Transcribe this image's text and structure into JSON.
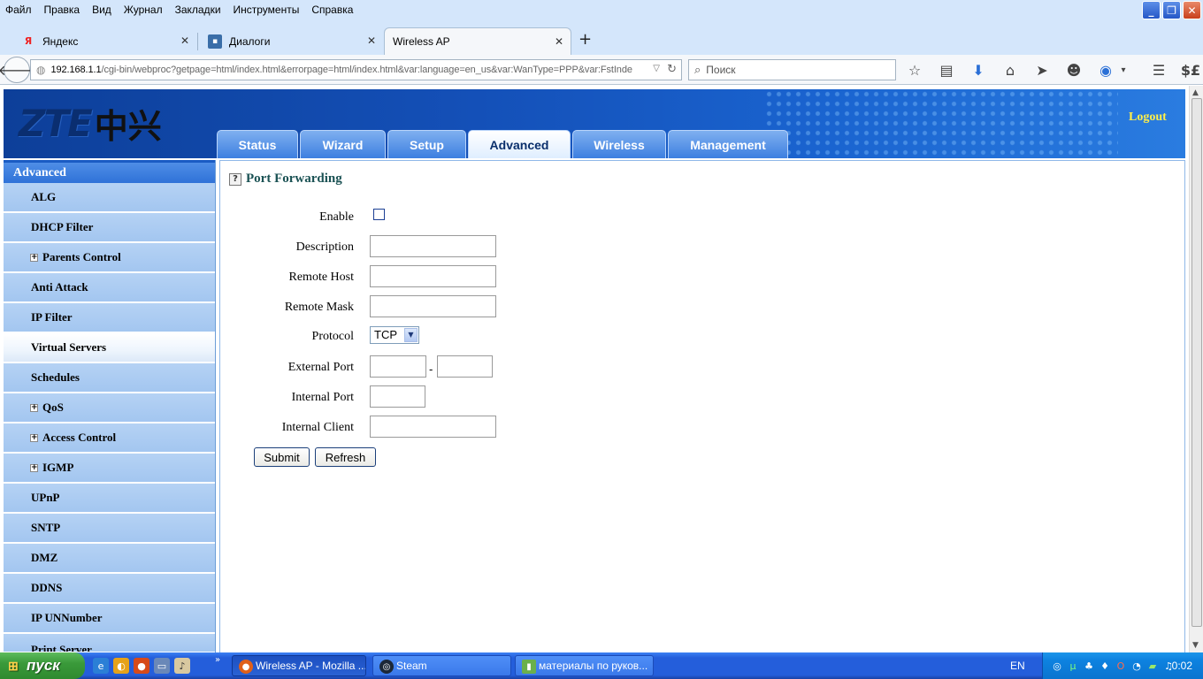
{
  "browser": {
    "menu": [
      "Файл",
      "Правка",
      "Вид",
      "Журнал",
      "Закладки",
      "Инструменты",
      "Справка"
    ],
    "window_buttons": {
      "minimize": "_",
      "restore": "❐",
      "close": "✕"
    },
    "tabs": [
      {
        "label": "Яндекс",
        "favicon": "Я"
      },
      {
        "label": "Диалоги",
        "favicon": "▪"
      },
      {
        "label": "Wireless AP",
        "favicon": ""
      }
    ],
    "newtab_glyph": "+",
    "url": {
      "host": "192.168.1.1",
      "path": "/cgi-bin/webproc?getpage=html/index.html&errorpage=html/index.html&var:language=en_us&var:WanType=PPP&var:FstInde"
    },
    "search_placeholder": "Поиск"
  },
  "router": {
    "logo_latin": "ZTE",
    "logo_cn": "中兴",
    "logout": "Logout",
    "tabs": [
      {
        "label": "Status",
        "active": false
      },
      {
        "label": "Wizard",
        "active": false
      },
      {
        "label": "Setup",
        "active": false
      },
      {
        "label": "Advanced",
        "active": true
      },
      {
        "label": "Wireless",
        "active": false
      },
      {
        "label": "Management",
        "active": false
      }
    ],
    "sidebar": {
      "heading": "Advanced",
      "items": [
        {
          "label": "ALG",
          "expandable": false
        },
        {
          "label": "DHCP Filter",
          "expandable": false
        },
        {
          "label": "Parents Control",
          "expandable": true
        },
        {
          "label": "Anti Attack",
          "expandable": false
        },
        {
          "label": "IP Filter",
          "expandable": false
        },
        {
          "label": "Virtual Servers",
          "expandable": false,
          "active": true
        },
        {
          "label": "Schedules",
          "expandable": false
        },
        {
          "label": "QoS",
          "expandable": true
        },
        {
          "label": "Access Control",
          "expandable": true
        },
        {
          "label": "IGMP",
          "expandable": true
        },
        {
          "label": "UPnP",
          "expandable": false
        },
        {
          "label": "SNTP",
          "expandable": false
        },
        {
          "label": "DMZ",
          "expandable": false
        },
        {
          "label": "DDNS",
          "expandable": false
        },
        {
          "label": "IP UNNumber",
          "expandable": false
        },
        {
          "label": "Print Server",
          "expandable": false
        }
      ]
    },
    "form": {
      "help": "?",
      "title": "Port Forwarding",
      "enable_label": "Enable",
      "enable_checked": false,
      "description_label": "Description",
      "remote_host_label": "Remote Host",
      "remote_mask_label": "Remote Mask",
      "protocol_label": "Protocol",
      "protocol_value": "TCP",
      "external_port_label": "External Port",
      "port_separator": "-",
      "internal_port_label": "Internal Port",
      "internal_client_label": "Internal Client",
      "submit": "Submit",
      "refresh": "Refresh"
    }
  },
  "taskbar": {
    "start": "пуск",
    "tasks": [
      {
        "label": "Wireless AP - Mozilla ...",
        "active": true
      },
      {
        "label": "Steam",
        "active": false
      },
      {
        "label": "материалы по руков...",
        "active": false
      }
    ],
    "language": "EN",
    "clock": "0:02"
  },
  "colors": {
    "router_header": "#1450b8",
    "logout": "#ffef4a",
    "sidebar": "#8fb8e8",
    "title": "#1b5254",
    "xp_taskbar": "#245edb",
    "xp_start": "#3a9a3a"
  }
}
